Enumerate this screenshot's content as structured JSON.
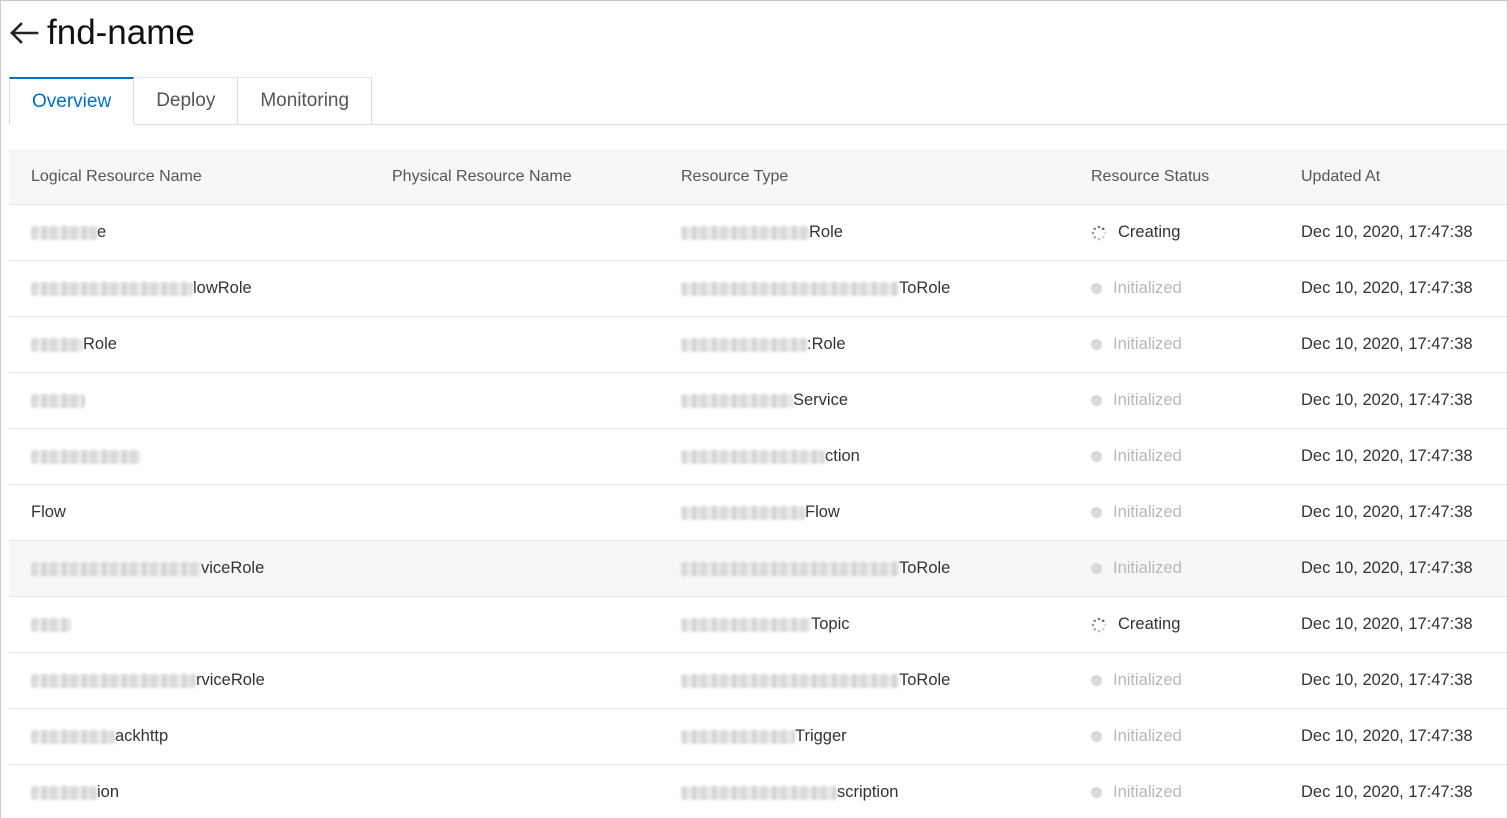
{
  "header": {
    "title": "fnd-name",
    "back_icon": "arrow-left-icon"
  },
  "tabs": [
    {
      "label": "Overview",
      "active": true
    },
    {
      "label": "Deploy",
      "active": false
    },
    {
      "label": "Monitoring",
      "active": false
    }
  ],
  "table": {
    "columns": [
      "Logical Resource Name",
      "Physical Resource Name",
      "Resource Type",
      "Resource Status",
      "Updated At"
    ],
    "rows": [
      {
        "logical": "e",
        "physical": "",
        "type": "Role",
        "status": "Creating",
        "updated": "Dec 10, 2020, 17:47:38"
      },
      {
        "logical": "lowRole",
        "physical": "",
        "type": "ToRole",
        "status": "Initialized",
        "updated": "Dec 10, 2020, 17:47:38"
      },
      {
        "logical": "Role",
        "physical": "",
        "type": ":Role",
        "status": "Initialized",
        "updated": "Dec 10, 2020, 17:47:38"
      },
      {
        "logical": "",
        "physical": "",
        "type": "Service",
        "status": "Initialized",
        "updated": "Dec 10, 2020, 17:47:38"
      },
      {
        "logical": "",
        "physical": "",
        "type": "ction",
        "status": "Initialized",
        "updated": "Dec 10, 2020, 17:47:38"
      },
      {
        "logical": "Flow",
        "physical": "",
        "type": "Flow",
        "status": "Initialized",
        "updated": "Dec 10, 2020, 17:47:38"
      },
      {
        "logical": "viceRole",
        "physical": "",
        "type": "ToRole",
        "status": "Initialized",
        "updated": "Dec 10, 2020, 17:47:38"
      },
      {
        "logical": "",
        "physical": "",
        "type": "Topic",
        "status": "Creating",
        "updated": "Dec 10, 2020, 17:47:38"
      },
      {
        "logical": "rviceRole",
        "physical": "",
        "type": "ToRole",
        "status": "Initialized",
        "updated": "Dec 10, 2020, 17:47:38"
      },
      {
        "logical": "ackhttp",
        "physical": "",
        "type": "Trigger",
        "status": "Initialized",
        "updated": "Dec 10, 2020, 17:47:38"
      },
      {
        "logical": "ion",
        "physical": "",
        "type": "scription",
        "status": "Initialized",
        "updated": "Dec 10, 2020, 17:47:38"
      }
    ]
  },
  "colors": {
    "accent": "#0070cc",
    "initialized_text": "#b8b8b8",
    "initialized_dot": "#d9d9d9",
    "header_bg": "#f7f7f7"
  }
}
